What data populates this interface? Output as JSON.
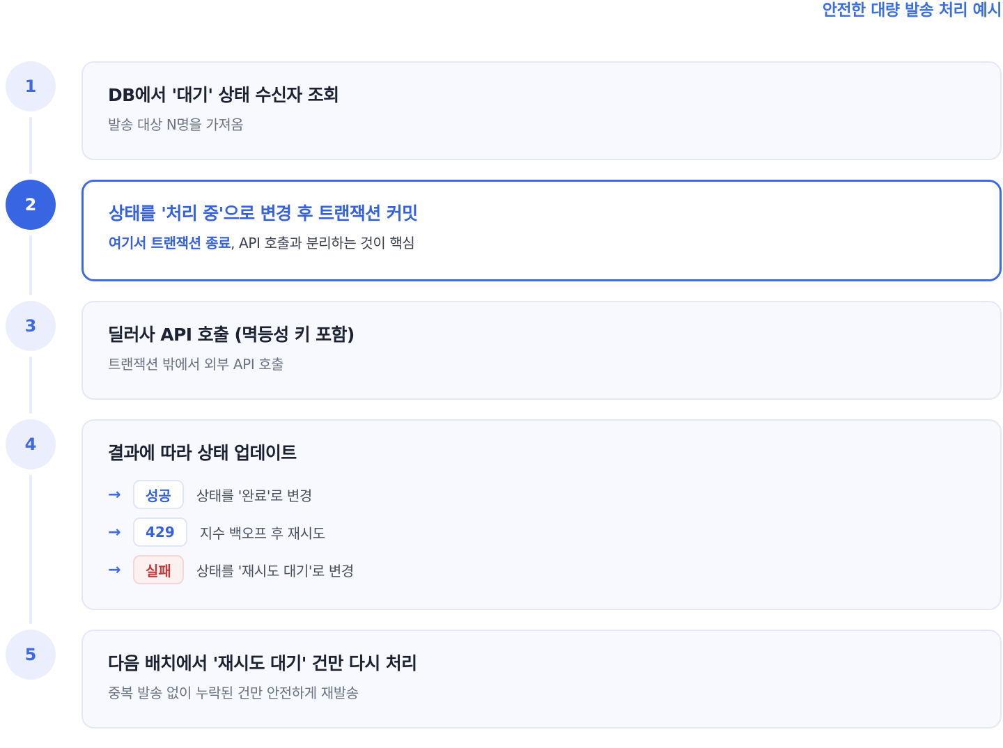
{
  "title": "안전한 대량 발송 처리 예시",
  "steps": [
    {
      "number": "1",
      "title": "DB에서 '대기' 상태 수신자 조회",
      "desc": "발송 대상 N명을 가져옴"
    },
    {
      "number": "2",
      "title": "상태를 '처리 중'으로 변경 후 트랜잭션 커밋",
      "desc_highlight": "여기서 트랜잭션 종료",
      "desc_rest": ", API 호출과 분리하는 것이 핵심"
    },
    {
      "number": "3",
      "title": "딜러사 API 호출 (멱등성 키 포함)",
      "desc": "트랜잭션 밖에서 외부 API 호출"
    },
    {
      "number": "4",
      "title": "결과에 따라 상태 업데이트",
      "outcomes": [
        {
          "badge": "성공",
          "text": "상태를 '완료'로 변경"
        },
        {
          "badge": "429",
          "text": "지수 백오프 후 재시도"
        },
        {
          "badge": "실패",
          "text": "상태를 '재시도 대기'로 변경"
        }
      ]
    },
    {
      "number": "5",
      "title": "다음 배치에서 '재시도 대기' 건만 다시 처리",
      "desc": "중복 발송 없이 누락된 건만 안전하게 재발송"
    }
  ],
  "colors": {
    "accent": "#3866e3",
    "fail": "#c0393b"
  }
}
